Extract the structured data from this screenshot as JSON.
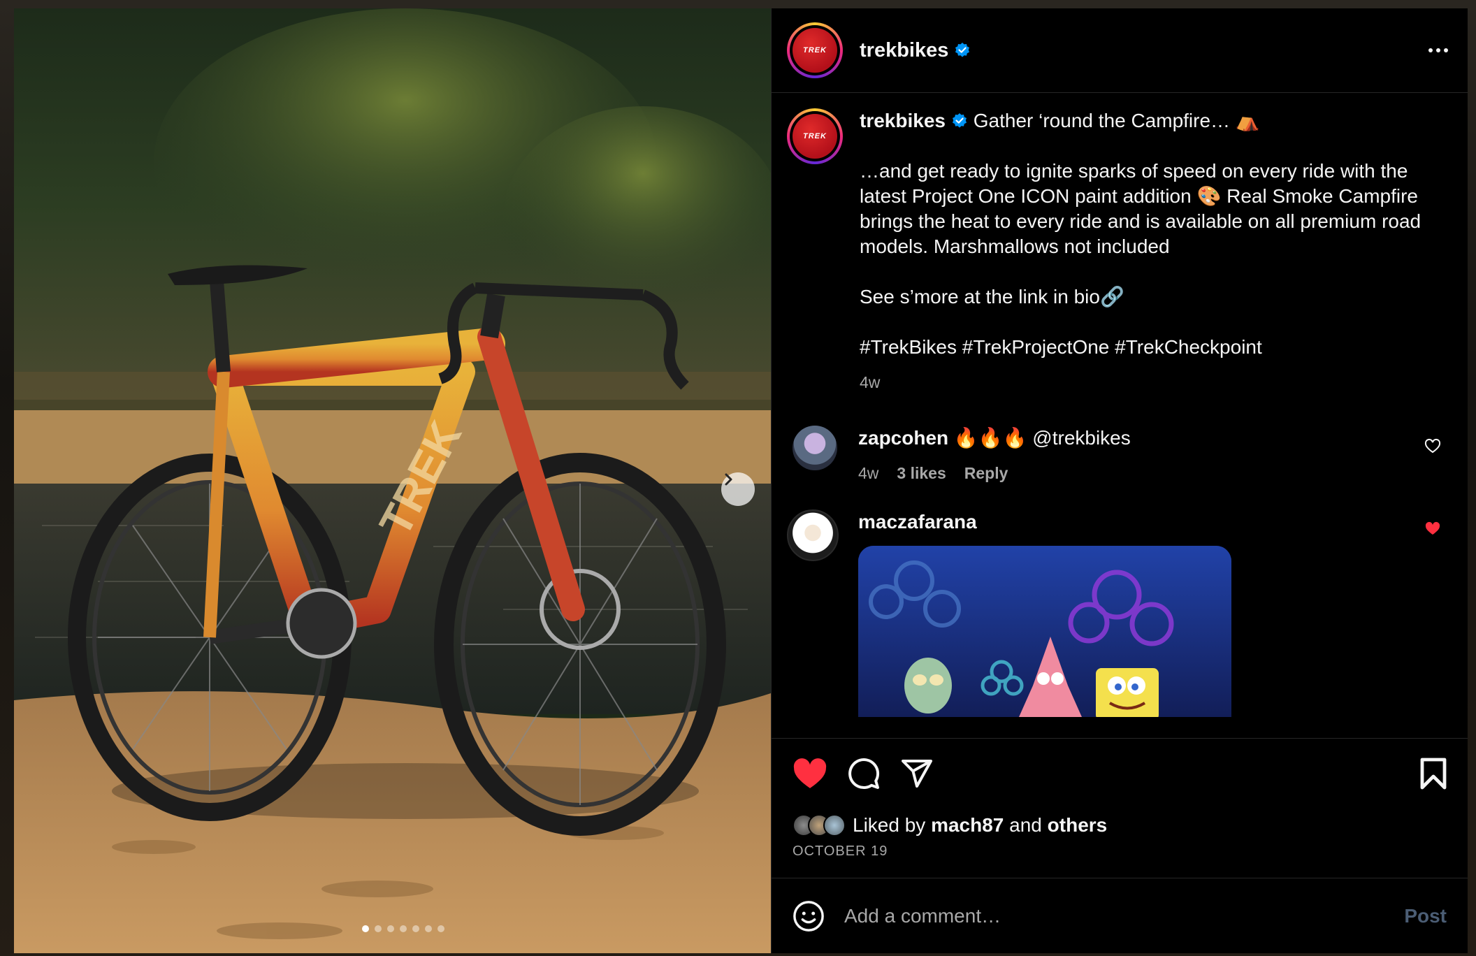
{
  "post": {
    "username": "trekbikes",
    "logo_text": "TREK",
    "caption_lines": [
      "Gather ‘round the Campfire… ⛺",
      "…and get ready to ignite sparks of speed on every ride with the latest Project One ICON paint addition 🎨 Real Smoke Campfire brings the heat to every ride and is available on all premium road models. Marshmallows not included",
      "See s’more at the link in bio🔗",
      "#TrekBikes #TrekProjectOne #TrekCheckpoint"
    ],
    "caption_age": "4w"
  },
  "comments": [
    {
      "username": "zapcohen",
      "text": "🔥🔥🔥 @trekbikes",
      "age": "4w",
      "likes": "3 likes",
      "reply": "Reply",
      "liked": false
    },
    {
      "username": "maczafarana",
      "has_gif": true,
      "liked": true
    }
  ],
  "actions": {
    "liked": true,
    "liked_by_prefix": "Liked by",
    "liked_by_user": "mach87",
    "liked_by_and": "and",
    "liked_by_others": "others",
    "date": "OCTOBER 19"
  },
  "add_comment": {
    "placeholder": "Add a comment…",
    "post_label": "Post"
  },
  "carousel": {
    "total": 7,
    "active": 0
  },
  "colors": {
    "heart_red": "#ff3040",
    "verified_blue": "#0095f6",
    "trek_red": "#c8141c"
  }
}
